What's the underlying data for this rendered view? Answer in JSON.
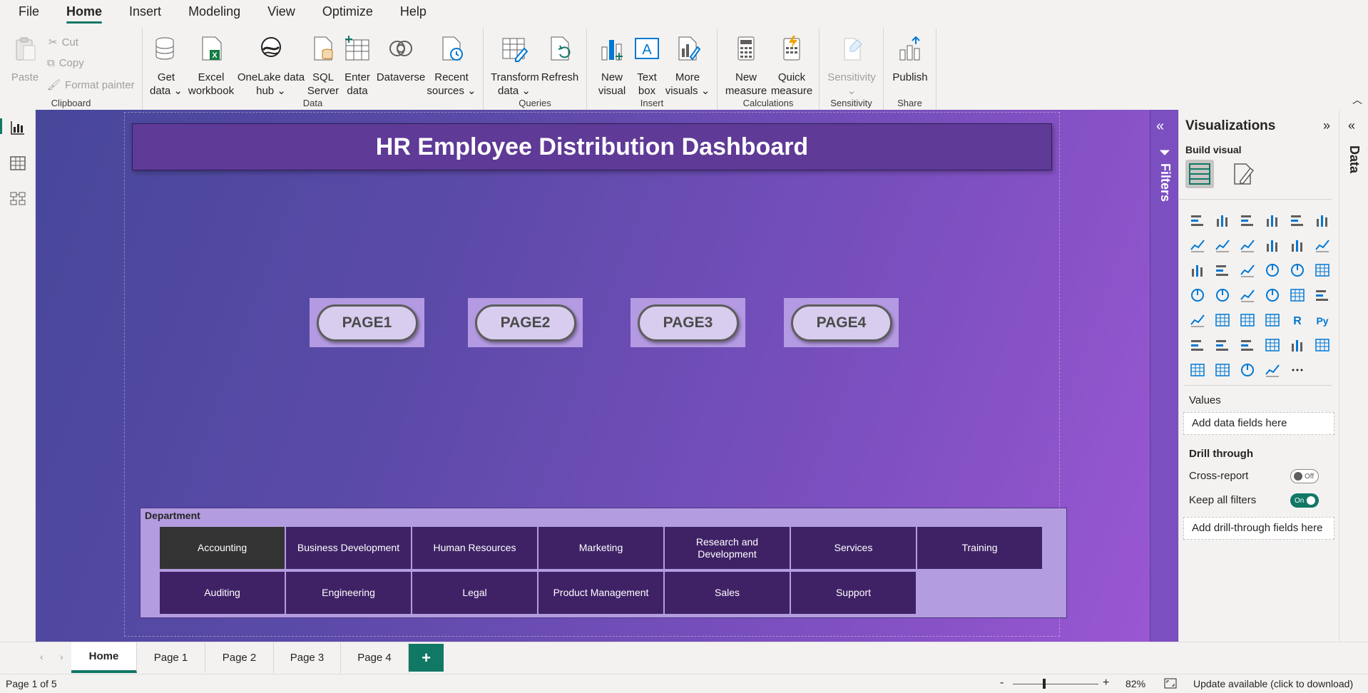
{
  "menu": {
    "tabs": [
      "File",
      "Home",
      "Insert",
      "Modeling",
      "View",
      "Optimize",
      "Help"
    ],
    "active": "Home"
  },
  "ribbon": {
    "clipboard": {
      "label": "Clipboard",
      "paste": "Paste",
      "cut": "Cut",
      "copy": "Copy",
      "format_painter": "Format painter"
    },
    "data": {
      "label": "Data",
      "get_data": [
        "Get",
        "data"
      ],
      "excel": [
        "Excel",
        "workbook"
      ],
      "onelake": [
        "OneLake data",
        "hub"
      ],
      "sql": [
        "SQL",
        "Server"
      ],
      "enter": [
        "Enter",
        "data"
      ],
      "dataverse": "Dataverse",
      "recent": [
        "Recent",
        "sources"
      ]
    },
    "queries": {
      "label": "Queries",
      "transform": [
        "Transform",
        "data"
      ],
      "refresh": "Refresh"
    },
    "insert": {
      "label": "Insert",
      "new_visual": [
        "New",
        "visual"
      ],
      "text_box": [
        "Text",
        "box"
      ],
      "more_visuals": [
        "More",
        "visuals"
      ]
    },
    "calculations": {
      "label": "Calculations",
      "new_measure": [
        "New",
        "measure"
      ],
      "quick_measure": [
        "Quick",
        "measure"
      ]
    },
    "sensitivity": {
      "label": "Sensitivity",
      "btn": "Sensitivity"
    },
    "share": {
      "label": "Share",
      "publish": "Publish"
    }
  },
  "report": {
    "title": "HR Employee Distribution Dashboard",
    "page_buttons": [
      "PAGE1",
      "PAGE2",
      "PAGE3",
      "PAGE4"
    ],
    "slicer": {
      "title": "Department",
      "selected": "Accounting",
      "row1": [
        "Accounting",
        "Business Development",
        "Human Resources",
        "Marketing",
        "Research and Development",
        "Services",
        "Training"
      ],
      "row2": [
        "Auditing",
        "Engineering",
        "Legal",
        "Product Management",
        "Sales",
        "Support"
      ]
    }
  },
  "filters": {
    "label": "Filters"
  },
  "visualizations": {
    "title": "Visualizations",
    "build_visual": "Build visual",
    "values_label": "Values",
    "values_placeholder": "Add data fields here",
    "drill_through": "Drill through",
    "cross_report": "Cross-report",
    "cross_report_state": "Off",
    "keep_all_filters": "Keep all filters",
    "keep_all_filters_state": "On",
    "drill_placeholder": "Add drill-through fields here",
    "more": "···"
  },
  "data_pane": {
    "label": "Data"
  },
  "page_tabs": {
    "tabs": [
      "Home",
      "Page 1",
      "Page 2",
      "Page 3",
      "Page 4"
    ],
    "active": "Home",
    "add": "+"
  },
  "status": {
    "page_info": "Page 1 of 5",
    "zoom_minus": "-",
    "zoom_plus": "+",
    "zoom": "82%",
    "update": "Update available (click to download)"
  },
  "colors": {
    "accent": "#117865",
    "canvas_start": "#47479a",
    "canvas_end": "#9a57d2",
    "slicer_chip": "#3f2266",
    "slicer_selected": "#333333"
  }
}
